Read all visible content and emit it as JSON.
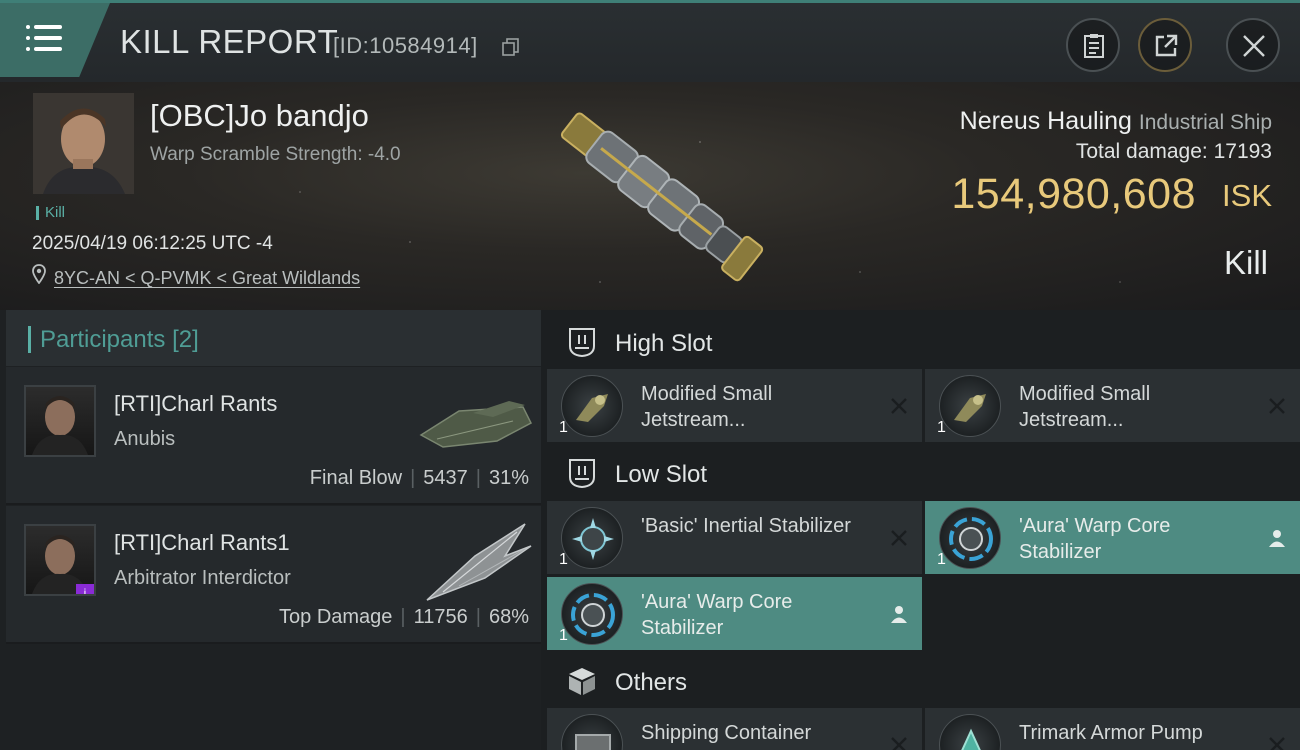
{
  "header": {
    "title": "KILL REPORT",
    "report_id": "[ID:10584914]"
  },
  "victim": {
    "name": "[OBC]Jo bandjo",
    "warp_scramble": "Warp Scramble Strength: -4.0",
    "kill_tag": "Kill",
    "datetime": "2025/04/19 06:12:25 UTC -4",
    "location": "8YC-AN < Q-PVMK < Great Wildlands"
  },
  "ship": {
    "name": "Nereus Hauling",
    "class": "Industrial Ship",
    "total_damage_label": "Total damage:",
    "total_damage": "17193",
    "isk_value": "154,980,608",
    "isk_unit": "ISK",
    "result": "Kill"
  },
  "participants": {
    "label": "Participants",
    "count": "[2]",
    "items": [
      {
        "name": "[RTI]Charl Rants",
        "ship": "Anubis",
        "role": "Final Blow",
        "damage": "5437",
        "percent": "31%"
      },
      {
        "name": "[RTI]Charl Rants1",
        "ship": "Arbitrator Interdictor",
        "role": "Top Damage",
        "damage": "11756",
        "percent": "68%"
      }
    ]
  },
  "slots": {
    "high": {
      "label": "High Slot",
      "items": [
        {
          "name": "Modified Small Jetstream...",
          "qty": "1"
        },
        {
          "name": "Modified Small Jetstream...",
          "qty": "1"
        }
      ]
    },
    "low": {
      "label": "Low Slot",
      "items": [
        {
          "name": "'Basic' Inertial Stabilizer",
          "qty": "1"
        },
        {
          "name": "'Aura' Warp Core Stabilizer",
          "qty": "1"
        },
        {
          "name": "'Aura' Warp Core Stabilizer",
          "qty": "1"
        }
      ]
    },
    "others": {
      "label": "Others",
      "items": [
        {
          "name": "Shipping Container",
          "qty": ""
        },
        {
          "name": "Trimark Armor Pump",
          "qty": ""
        }
      ]
    }
  },
  "colors": {
    "accent": "#5ab0a6",
    "isk": "#e8c97b",
    "selected": "#4e8b82"
  }
}
